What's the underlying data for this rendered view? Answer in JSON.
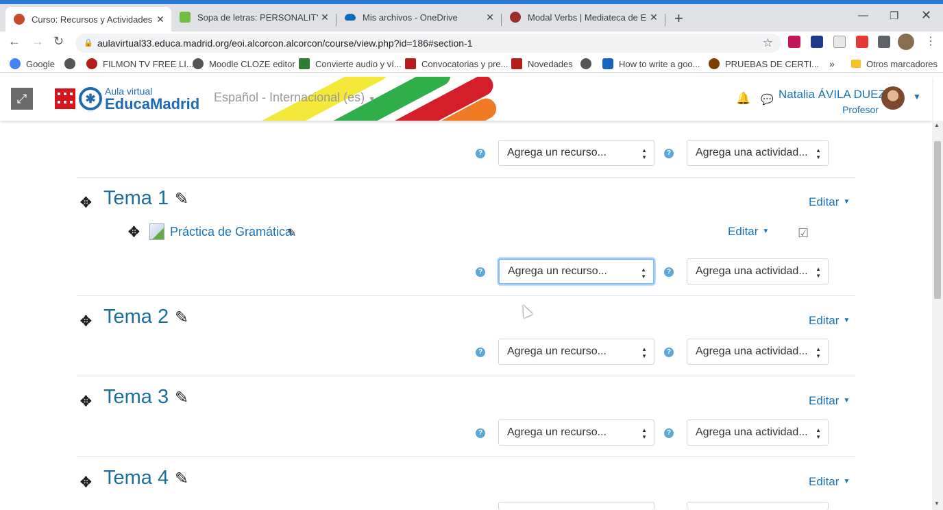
{
  "browser": {
    "tabs": [
      {
        "title": "Curso: Recursos y Actividades",
        "active": true,
        "color": "#c74a2a"
      },
      {
        "title": "Sopa de letras: PERSONALITY AD",
        "active": false,
        "color": "#6fbe44"
      },
      {
        "title": "Mis archivos - OneDrive",
        "active": false,
        "color": "#0f6cbd"
      },
      {
        "title": "Modal Verbs | Mediateca de Educ",
        "active": false,
        "color": "#9b2d2d"
      }
    ],
    "url": "aulavirtual33.educa.madrid.org/eoi.alcorcon.alcorcon/course/view.php?id=186#section-1",
    "bookmarks": [
      {
        "label": "Google",
        "color": "#4285f4"
      },
      {
        "label": "",
        "color": "#555"
      },
      {
        "label": "FILMON TV FREE LI...",
        "color": "#b71c1c"
      },
      {
        "label": "Moodle CLOZE editor",
        "color": "#555"
      },
      {
        "label": "Convierte audio y ví...",
        "color": "#2e7d32"
      },
      {
        "label": "Convocatorias y pre...",
        "color": "#b71c1c"
      },
      {
        "label": "Novedades",
        "color": "#b71c1c"
      },
      {
        "label": "",
        "color": "#555"
      },
      {
        "label": "How to write a goo...",
        "color": "#1565c0"
      },
      {
        "label": "PRUEBAS DE CERTI...",
        "color": "#7b3f00"
      }
    ],
    "other_bookmarks": "Otros marcadores"
  },
  "header": {
    "logo_small": "Aula virtual",
    "logo_big": "EducaMadrid",
    "language": "Español - Internacional (es)",
    "user_name": "Natalia ÁVILA DUEZ",
    "user_role": "Profesor"
  },
  "course": {
    "add_resource": "Agrega un recurso...",
    "add_activity": "Agrega una actividad...",
    "edit": "Editar",
    "sections": [
      {
        "title": "Tema 1"
      },
      {
        "title": "Tema 2"
      },
      {
        "title": "Tema 3"
      },
      {
        "title": "Tema 4"
      }
    ],
    "activity": {
      "name": "Práctica de Gramática"
    }
  }
}
